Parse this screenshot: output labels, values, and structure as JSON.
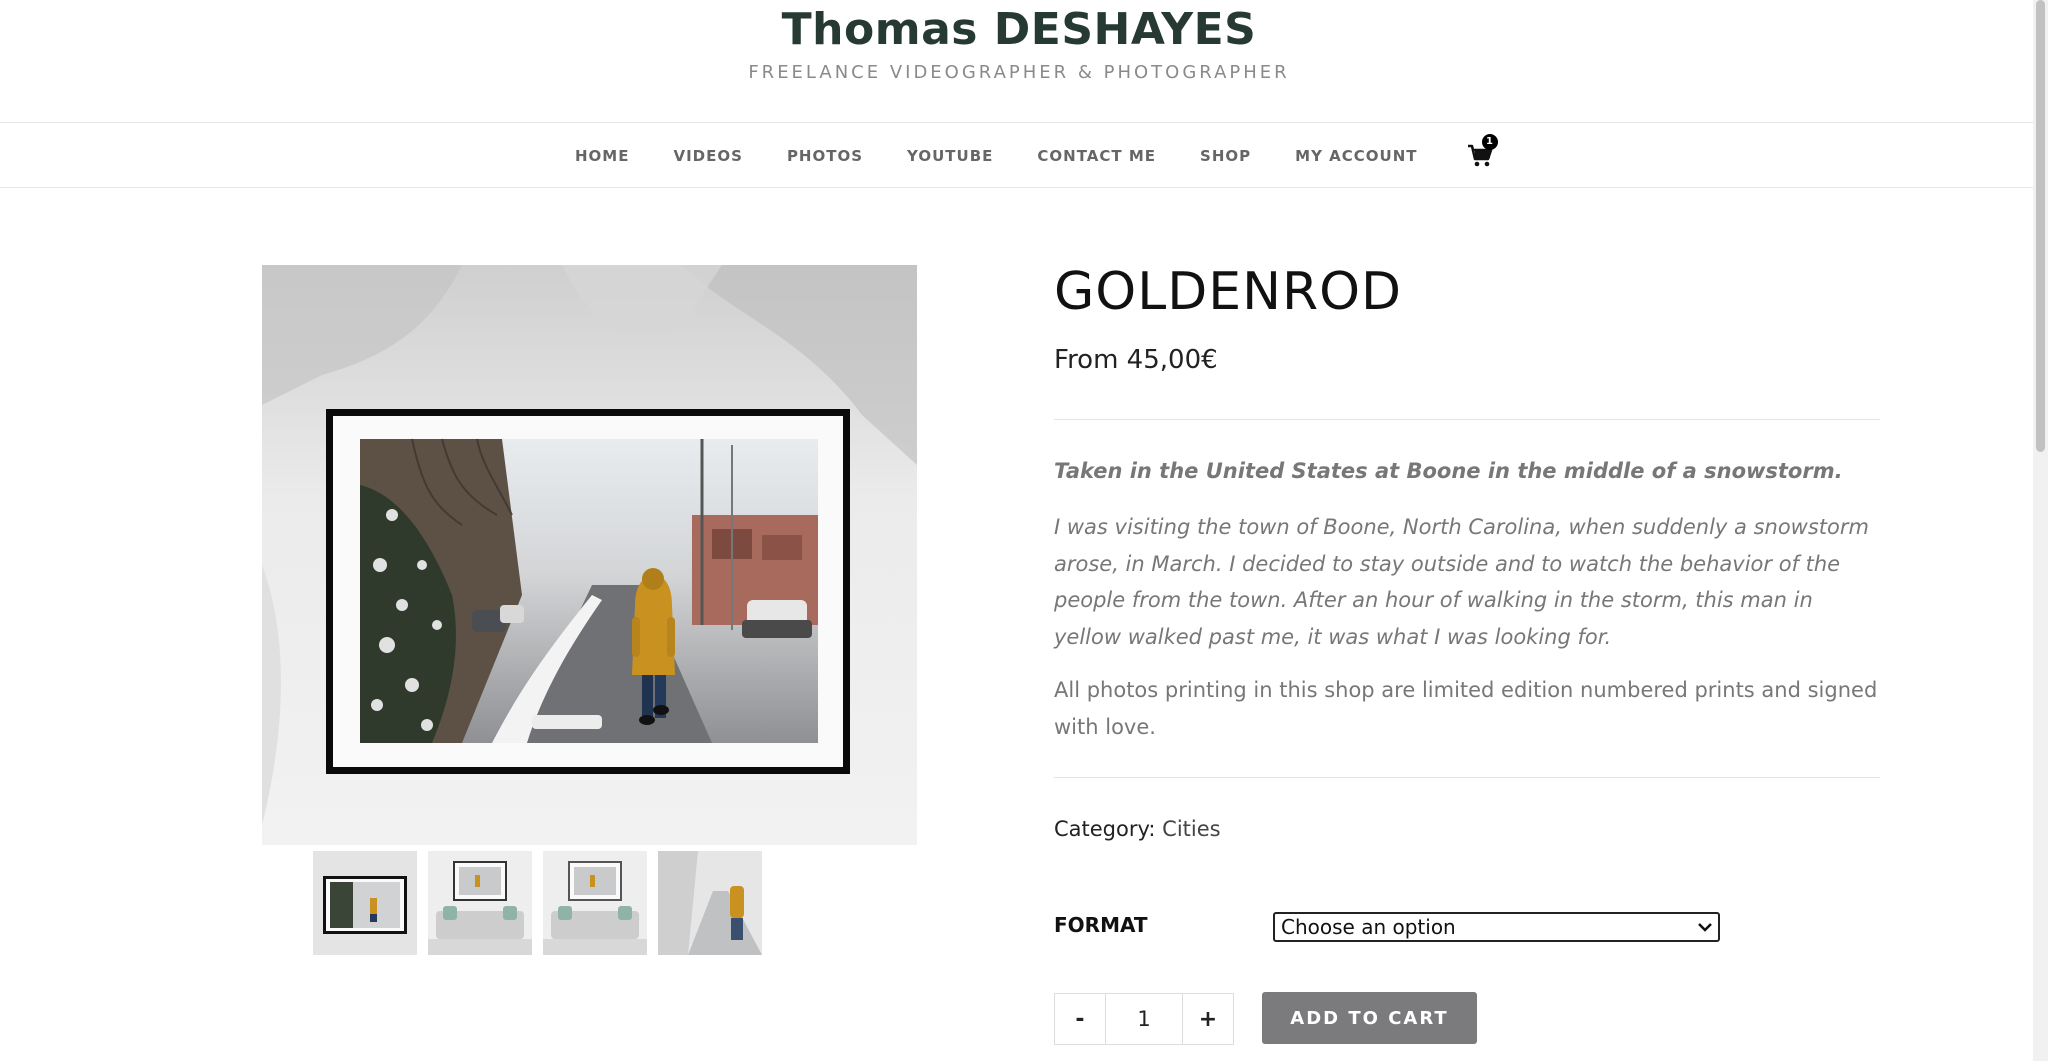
{
  "site": {
    "title": "Thomas DESHAYES",
    "tagline": "FREELANCE VIDEOGRAPHER & PHOTOGRAPHER"
  },
  "nav": {
    "items": [
      "HOME",
      "VIDEOS",
      "PHOTOS",
      "YOUTUBE",
      "CONTACT ME",
      "SHOP",
      "MY ACCOUNT"
    ],
    "cart_count": "1",
    "cart_icon": "shopping-cart-icon"
  },
  "product": {
    "title": "GOLDENROD",
    "price": "From 45,00€",
    "desc_strong": "Taken in the United States at  Boone in the middle of a snowstorm.",
    "desc_italic": "I was visiting the town of Boone, North Carolina, when suddenly a snowstorm arose, in March. I decided to stay outside and to watch the behavior of the people from the town. After an hour of walking in the storm, this man in yellow walked past me, it was what I was looking for.",
    "desc_plain": "All photos printing in this shop are limited edition numbered prints and signed with love.",
    "category_label": "Category:",
    "category_value": "Cities",
    "format_label": "FORMAT",
    "format_selected": "Choose an option",
    "quantity": "1",
    "qty_minus": "-",
    "qty_plus": "+",
    "add_to_cart": "ADD TO CART"
  },
  "colors": {
    "accent_button": "#7b7b7d",
    "title_color": "#263a33",
    "coat_yellow": "#c99220"
  }
}
